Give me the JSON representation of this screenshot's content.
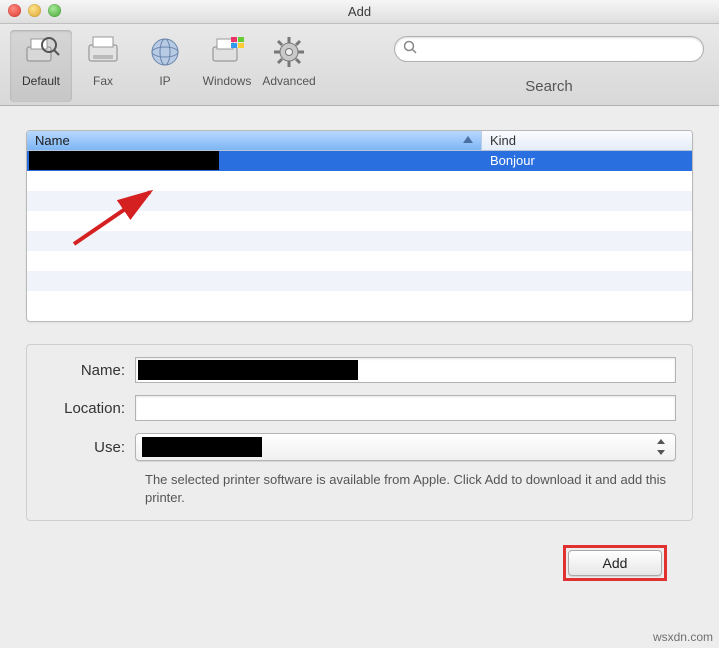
{
  "window": {
    "title": "Add"
  },
  "toolbar": {
    "items": [
      {
        "label": "Default",
        "selected": true
      },
      {
        "label": "Fax"
      },
      {
        "label": "IP"
      },
      {
        "label": "Windows"
      },
      {
        "label": "Advanced"
      }
    ],
    "search": {
      "placeholder": "",
      "label": "Search"
    }
  },
  "printer_list": {
    "columns": {
      "name": "Name",
      "kind": "Kind"
    },
    "sort_column": "name",
    "sort_dir": "asc",
    "rows": [
      {
        "name": "",
        "name_redacted": true,
        "kind": "Bonjour",
        "selected": true
      }
    ]
  },
  "form": {
    "name_label": "Name:",
    "name_value": "",
    "name_redacted": true,
    "location_label": "Location:",
    "location_value": "",
    "use_label": "Use:",
    "use_value": "",
    "use_redacted": true,
    "hint": "The selected printer software is available from Apple. Click Add to download it and add this printer."
  },
  "footer": {
    "add_label": "Add"
  },
  "watermark": "wsxdn.com"
}
